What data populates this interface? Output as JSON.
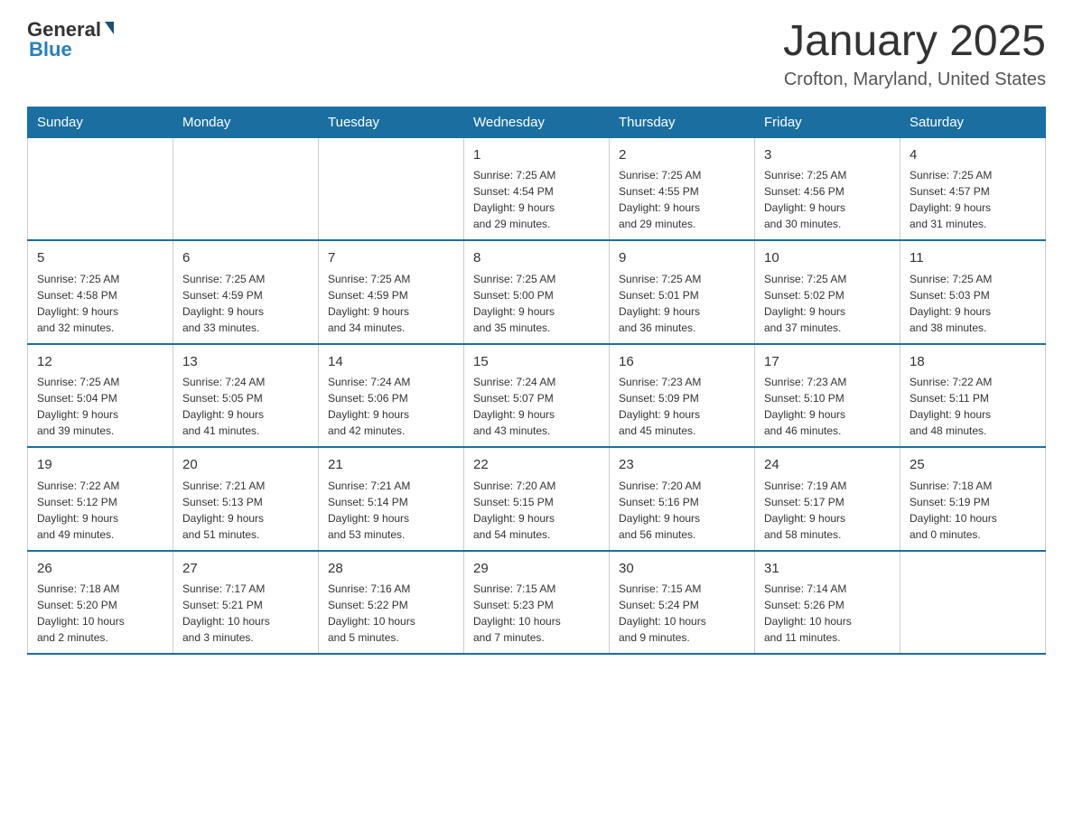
{
  "header": {
    "logo": {
      "general": "General",
      "blue": "Blue"
    },
    "title": "January 2025",
    "location": "Crofton, Maryland, United States"
  },
  "days_of_week": [
    "Sunday",
    "Monday",
    "Tuesday",
    "Wednesday",
    "Thursday",
    "Friday",
    "Saturday"
  ],
  "weeks": [
    [
      {
        "day": "",
        "info": ""
      },
      {
        "day": "",
        "info": ""
      },
      {
        "day": "",
        "info": ""
      },
      {
        "day": "1",
        "info": "Sunrise: 7:25 AM\nSunset: 4:54 PM\nDaylight: 9 hours\nand 29 minutes."
      },
      {
        "day": "2",
        "info": "Sunrise: 7:25 AM\nSunset: 4:55 PM\nDaylight: 9 hours\nand 29 minutes."
      },
      {
        "day": "3",
        "info": "Sunrise: 7:25 AM\nSunset: 4:56 PM\nDaylight: 9 hours\nand 30 minutes."
      },
      {
        "day": "4",
        "info": "Sunrise: 7:25 AM\nSunset: 4:57 PM\nDaylight: 9 hours\nand 31 minutes."
      }
    ],
    [
      {
        "day": "5",
        "info": "Sunrise: 7:25 AM\nSunset: 4:58 PM\nDaylight: 9 hours\nand 32 minutes."
      },
      {
        "day": "6",
        "info": "Sunrise: 7:25 AM\nSunset: 4:59 PM\nDaylight: 9 hours\nand 33 minutes."
      },
      {
        "day": "7",
        "info": "Sunrise: 7:25 AM\nSunset: 4:59 PM\nDaylight: 9 hours\nand 34 minutes."
      },
      {
        "day": "8",
        "info": "Sunrise: 7:25 AM\nSunset: 5:00 PM\nDaylight: 9 hours\nand 35 minutes."
      },
      {
        "day": "9",
        "info": "Sunrise: 7:25 AM\nSunset: 5:01 PM\nDaylight: 9 hours\nand 36 minutes."
      },
      {
        "day": "10",
        "info": "Sunrise: 7:25 AM\nSunset: 5:02 PM\nDaylight: 9 hours\nand 37 minutes."
      },
      {
        "day": "11",
        "info": "Sunrise: 7:25 AM\nSunset: 5:03 PM\nDaylight: 9 hours\nand 38 minutes."
      }
    ],
    [
      {
        "day": "12",
        "info": "Sunrise: 7:25 AM\nSunset: 5:04 PM\nDaylight: 9 hours\nand 39 minutes."
      },
      {
        "day": "13",
        "info": "Sunrise: 7:24 AM\nSunset: 5:05 PM\nDaylight: 9 hours\nand 41 minutes."
      },
      {
        "day": "14",
        "info": "Sunrise: 7:24 AM\nSunset: 5:06 PM\nDaylight: 9 hours\nand 42 minutes."
      },
      {
        "day": "15",
        "info": "Sunrise: 7:24 AM\nSunset: 5:07 PM\nDaylight: 9 hours\nand 43 minutes."
      },
      {
        "day": "16",
        "info": "Sunrise: 7:23 AM\nSunset: 5:09 PM\nDaylight: 9 hours\nand 45 minutes."
      },
      {
        "day": "17",
        "info": "Sunrise: 7:23 AM\nSunset: 5:10 PM\nDaylight: 9 hours\nand 46 minutes."
      },
      {
        "day": "18",
        "info": "Sunrise: 7:22 AM\nSunset: 5:11 PM\nDaylight: 9 hours\nand 48 minutes."
      }
    ],
    [
      {
        "day": "19",
        "info": "Sunrise: 7:22 AM\nSunset: 5:12 PM\nDaylight: 9 hours\nand 49 minutes."
      },
      {
        "day": "20",
        "info": "Sunrise: 7:21 AM\nSunset: 5:13 PM\nDaylight: 9 hours\nand 51 minutes."
      },
      {
        "day": "21",
        "info": "Sunrise: 7:21 AM\nSunset: 5:14 PM\nDaylight: 9 hours\nand 53 minutes."
      },
      {
        "day": "22",
        "info": "Sunrise: 7:20 AM\nSunset: 5:15 PM\nDaylight: 9 hours\nand 54 minutes."
      },
      {
        "day": "23",
        "info": "Sunrise: 7:20 AM\nSunset: 5:16 PM\nDaylight: 9 hours\nand 56 minutes."
      },
      {
        "day": "24",
        "info": "Sunrise: 7:19 AM\nSunset: 5:17 PM\nDaylight: 9 hours\nand 58 minutes."
      },
      {
        "day": "25",
        "info": "Sunrise: 7:18 AM\nSunset: 5:19 PM\nDaylight: 10 hours\nand 0 minutes."
      }
    ],
    [
      {
        "day": "26",
        "info": "Sunrise: 7:18 AM\nSunset: 5:20 PM\nDaylight: 10 hours\nand 2 minutes."
      },
      {
        "day": "27",
        "info": "Sunrise: 7:17 AM\nSunset: 5:21 PM\nDaylight: 10 hours\nand 3 minutes."
      },
      {
        "day": "28",
        "info": "Sunrise: 7:16 AM\nSunset: 5:22 PM\nDaylight: 10 hours\nand 5 minutes."
      },
      {
        "day": "29",
        "info": "Sunrise: 7:15 AM\nSunset: 5:23 PM\nDaylight: 10 hours\nand 7 minutes."
      },
      {
        "day": "30",
        "info": "Sunrise: 7:15 AM\nSunset: 5:24 PM\nDaylight: 10 hours\nand 9 minutes."
      },
      {
        "day": "31",
        "info": "Sunrise: 7:14 AM\nSunset: 5:26 PM\nDaylight: 10 hours\nand 11 minutes."
      },
      {
        "day": "",
        "info": ""
      }
    ]
  ]
}
